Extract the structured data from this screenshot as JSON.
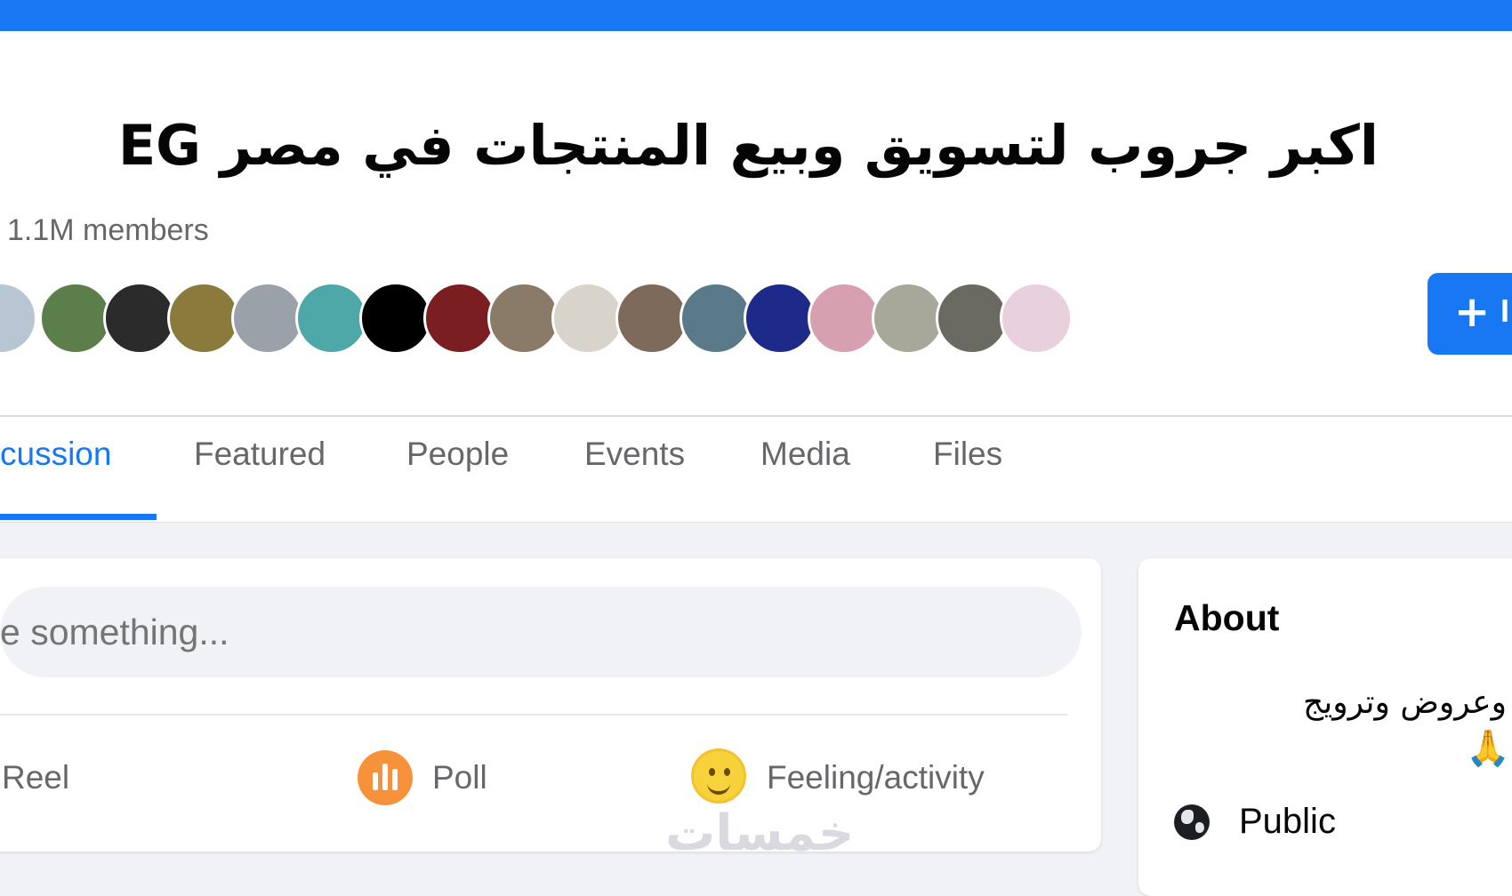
{
  "group": {
    "title": "اكبر جروب لتسويق وبيع المنتجات في مصر EG",
    "member_count": "1.1M members",
    "join_label": "+",
    "join_text": "I"
  },
  "avatars": [
    {
      "color": "#b8c6d4"
    },
    {
      "color": "#5b7e4a"
    },
    {
      "color": "#2b2b2b"
    },
    {
      "color": "#8a7a3c"
    },
    {
      "color": "#9aa1a8"
    },
    {
      "color": "#4fa8a8"
    },
    {
      "color": "#000000"
    },
    {
      "color": "#7a1e22"
    },
    {
      "color": "#8a7a68"
    },
    {
      "color": "#d8d4cc"
    },
    {
      "color": "#7e6a5a"
    },
    {
      "color": "#5a7a8a"
    },
    {
      "color": "#1e2a8a"
    },
    {
      "color": "#d6a0b0"
    },
    {
      "color": "#a8a89a"
    },
    {
      "color": "#6a6a62"
    },
    {
      "color": "#e8d0dc"
    }
  ],
  "tabs": [
    {
      "label": "cussion",
      "active": true
    },
    {
      "label": "Featured",
      "active": false
    },
    {
      "label": "People",
      "active": false
    },
    {
      "label": "Events",
      "active": false
    },
    {
      "label": "Media",
      "active": false
    },
    {
      "label": "Files",
      "active": false
    }
  ],
  "composer": {
    "placeholder": "e something...",
    "actions": [
      {
        "label": "Reel"
      },
      {
        "label": "Poll"
      },
      {
        "label": "Feeling/activity"
      }
    ]
  },
  "about": {
    "title": "About",
    "description": "وعروض وترويج",
    "emoji": "🙏",
    "privacy": "Public"
  },
  "watermark": "خمسات",
  "colors": {
    "brand": "#1877f2",
    "poll": "#f7923a",
    "feeling": "#f7d23a"
  }
}
